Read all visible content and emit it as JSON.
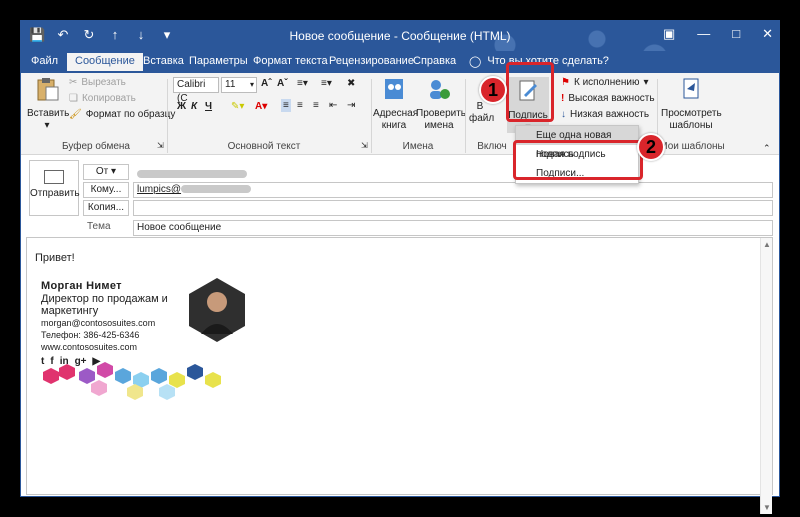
{
  "window": {
    "title": "Новое сообщение - Сообщение (HTML)",
    "accent": "#2b579a"
  },
  "tabs": [
    {
      "label": "Файл"
    },
    {
      "label": "Сообщение"
    },
    {
      "label": "Вставка"
    },
    {
      "label": "Параметры"
    },
    {
      "label": "Формат текста"
    },
    {
      "label": "Рецензирование"
    },
    {
      "label": "Справка"
    }
  ],
  "tellme": "Что вы хотите сделать?",
  "clipboard": {
    "paste": "Вставить",
    "cut": "Вырезать",
    "copy": "Копировать",
    "format_painter": "Формат по образцу",
    "label": "Буфер обмена"
  },
  "font": {
    "family": "Calibri (C",
    "size": "11",
    "label": "Основной текст"
  },
  "names": {
    "address_book_1": "Адресная",
    "address_book_2": "книга",
    "check_names_1": "Проверить",
    "check_names_2": "имена",
    "label": "Имена"
  },
  "include": {
    "attach_file_1": "В",
    "attach_file_2": "файл",
    "signature": "Подпись",
    "label": "Включ"
  },
  "tags": {
    "followup": "К исполнению",
    "high": "Высокая важность",
    "low": "Низкая важность"
  },
  "templates": {
    "view_1": "Просмотреть",
    "view_2": "шаблоны",
    "label": "Мои шаблоны"
  },
  "signature_menu": [
    {
      "label": "Еще одна новая подпись"
    },
    {
      "label": "Новая подпись"
    },
    {
      "label": "Подписи..."
    }
  ],
  "badges": {
    "one": "1",
    "two": "2"
  },
  "header": {
    "send": "Отправить",
    "from": "От",
    "to": "Кому...",
    "cc": "Копия...",
    "subject_label": "Тема",
    "to_value": "lumpics@",
    "subject_value": "Новое сообщение"
  },
  "message": {
    "greeting": "Привет!",
    "sig_name": "Морган Нимет",
    "sig_title": "Директор по продажам и маркетингу",
    "sig_email": "morgan@contososuites.com",
    "sig_phone": "Телефон: 386-425-6346",
    "sig_web": "www.contososuites.com"
  }
}
